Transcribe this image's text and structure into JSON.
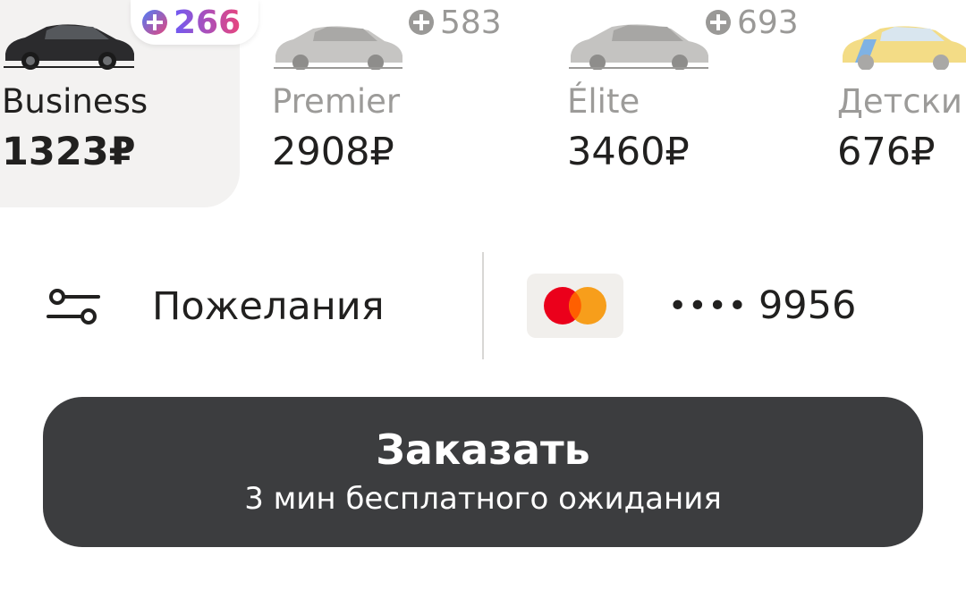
{
  "tariffs": [
    {
      "name": "Business",
      "price": "1323₽",
      "cashback": "266",
      "selected": true
    },
    {
      "name": "Premier",
      "price": "2908₽",
      "cashback": "583",
      "selected": false
    },
    {
      "name": "Élite",
      "price": "3460₽",
      "cashback": "693",
      "selected": false
    },
    {
      "name": "Детски",
      "price": "676₽",
      "selected": false
    }
  ],
  "options": {
    "wishes_label": "Пожелания",
    "payment": {
      "card_brand": "mastercard",
      "masked": "••••",
      "last4": "9956"
    }
  },
  "order": {
    "title": "Заказать",
    "subtitle": "3 мин бесплатного ожидания"
  },
  "icons": {
    "cashback": "plus-cashback-icon",
    "wishes": "sliders-icon",
    "card": "mastercard-icon"
  },
  "colors": {
    "selected_tile_bg": "#f3f2f1",
    "order_button_bg": "#3c3d3f",
    "muted_text": "#9c9b99",
    "mastercard_red": "#eb001b",
    "mastercard_orange": "#f79e1b"
  }
}
